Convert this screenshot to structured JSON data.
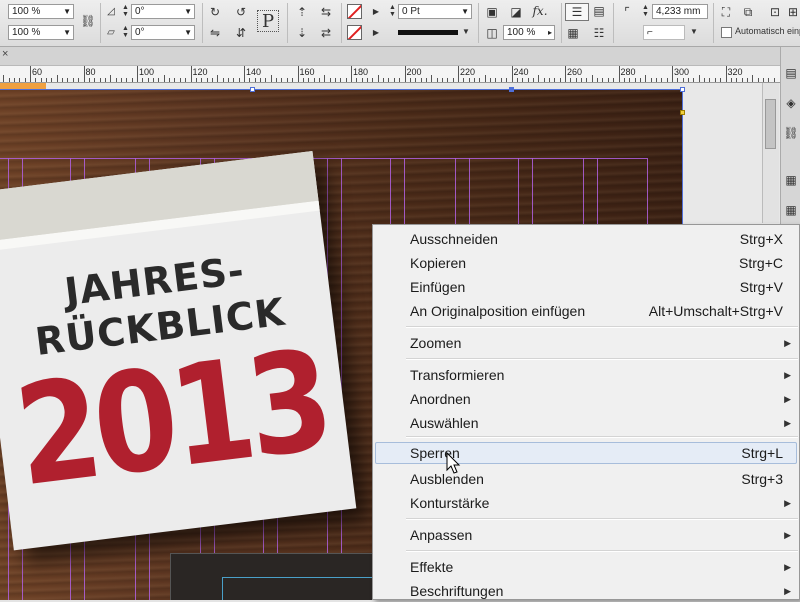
{
  "control_panel": {
    "scale_x": "100 %",
    "scale_y": "100 %",
    "rotation": "0°",
    "shear": "0°",
    "stroke_weight": "0 Pt",
    "opacity": "100 %",
    "dimension": "4,233 mm",
    "auto_fit_label": "Automatisch einp",
    "glyph_P": "P",
    "fx_label": "fx."
  },
  "ruler": {
    "labels": [
      "60",
      "80",
      "100",
      "120",
      "140",
      "160",
      "180",
      "200",
      "220",
      "240",
      "260",
      "280",
      "300",
      "320"
    ]
  },
  "calendar": {
    "title_line1": "JAHRES-",
    "title_line2": "RÜCKBLICK",
    "year": "2013"
  },
  "context_menu": {
    "items": [
      {
        "label": "Ausschneiden",
        "shortcut": "Strg+X",
        "submenu": false
      },
      {
        "label": "Kopieren",
        "shortcut": "Strg+C",
        "submenu": false
      },
      {
        "label": "Einfügen",
        "shortcut": "Strg+V",
        "submenu": false
      },
      {
        "label": "An Originalposition einfügen",
        "shortcut": "Alt+Umschalt+Strg+V",
        "submenu": false
      },
      {
        "label": "Zoomen",
        "shortcut": "",
        "submenu": true
      },
      {
        "label": "Transformieren",
        "shortcut": "",
        "submenu": true
      },
      {
        "label": "Anordnen",
        "shortcut": "",
        "submenu": true
      },
      {
        "label": "Auswählen",
        "shortcut": "",
        "submenu": true
      },
      {
        "label": "Sperren",
        "shortcut": "Strg+L",
        "submenu": false,
        "hovered": true
      },
      {
        "label": "Ausblenden",
        "shortcut": "Strg+3",
        "submenu": false
      },
      {
        "label": "Konturstärke",
        "shortcut": "",
        "submenu": true
      },
      {
        "label": "Anpassen",
        "shortcut": "",
        "submenu": true
      },
      {
        "label": "Effekte",
        "shortcut": "",
        "submenu": true
      },
      {
        "label": "Beschriftungen",
        "shortcut": "",
        "submenu": true
      }
    ]
  },
  "colors": {
    "selection_frame": "#4f6fd8",
    "guides": "#b060e0",
    "year_red": "#b0202e",
    "menu_hover": "#e5ecf6"
  }
}
